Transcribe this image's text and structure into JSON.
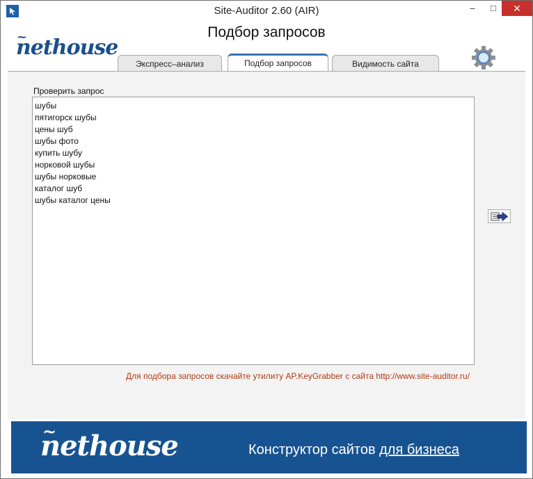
{
  "window": {
    "title": "Site-Auditor 2.60 (AIR)",
    "minimize": "–",
    "maximize": "□",
    "close": "✕"
  },
  "header": {
    "logo": "nethouse",
    "page_title": "Подбор запросов",
    "tabs": [
      {
        "label": "Экспресс–анализ",
        "active": false
      },
      {
        "label": "Подбор запросов",
        "active": true
      },
      {
        "label": "Видимость сайта",
        "active": false
      }
    ],
    "settings_icon": "gear-icon"
  },
  "main": {
    "field_label": "Проверить запрос",
    "queries": [
      "шубы",
      "пятигорск шубы",
      "цены шуб",
      "шубы фото",
      "купить шубу",
      "норковой шубы",
      "шубы норковые",
      "каталог шуб",
      "шубы каталог цены"
    ],
    "run_icon": "arrow-right-icon",
    "hint": "Для подбора запросов скачайте утилиту AP.KeyGrabber с сайта http://www.site-auditor.ru/"
  },
  "banner": {
    "logo": "nethouse",
    "text_plain": "Конструктор сайтов ",
    "text_link": "для бизнеса",
    "bg_color": "#185391"
  },
  "colors": {
    "accent": "#1a4f8c",
    "hint": "#b23a10",
    "close_button": "#c7302c"
  }
}
